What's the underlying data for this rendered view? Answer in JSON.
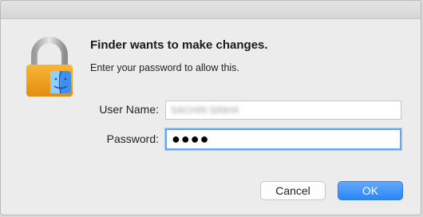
{
  "dialog": {
    "title": "Finder wants to make changes.",
    "subtitle": "Enter your password to allow this."
  },
  "form": {
    "username_label": "User Name:",
    "username_value": "SACHIN SINHA",
    "password_label": "Password:",
    "password_value": "●●●●"
  },
  "buttons": {
    "cancel": "Cancel",
    "ok": "OK"
  },
  "icons": {
    "lock": "padlock-icon",
    "finder": "finder-icon"
  },
  "colors": {
    "accent": "#2a86f6",
    "lock_body": "#f0a21e",
    "focus_ring": "#6aa6ec"
  }
}
